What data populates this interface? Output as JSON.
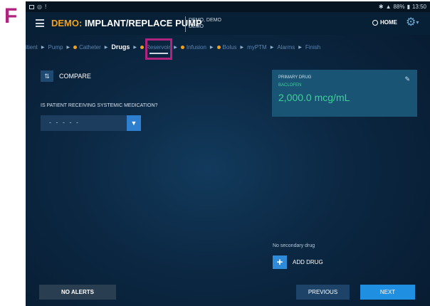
{
  "panel_label": "F",
  "status_bar": {
    "left_icons": [
      "image-icon",
      "target-icon",
      "alert-icon"
    ],
    "right_text": "88%",
    "time": "13:50"
  },
  "header": {
    "title_prefix": "DEMO:",
    "title_main": "IMPLANT/REPLACE PUMP",
    "patient_line1": "DEMO, DEMO",
    "patient_line2": "DEMO",
    "home_label": "HOME"
  },
  "steps": [
    {
      "label": "itient",
      "dot": false,
      "active": false
    },
    {
      "label": "Pump",
      "dot": false,
      "active": false
    },
    {
      "label": "Catheter",
      "dot": true,
      "active": false
    },
    {
      "label": "Drugs",
      "dot": false,
      "active": true
    },
    {
      "label": "Reservoir",
      "dot": true,
      "active": false
    },
    {
      "label": "Infusion",
      "dot": true,
      "active": false
    },
    {
      "label": "Bolus",
      "dot": true,
      "active": false
    },
    {
      "label": "myPTM",
      "dot": false,
      "active": false
    },
    {
      "label": "Alarms",
      "dot": false,
      "active": false
    },
    {
      "label": "Finish",
      "dot": false,
      "active": false
    }
  ],
  "compare": {
    "label": "COMPARE"
  },
  "systemic": {
    "question": "IS PATIENT RECEIVING SYSTEMIC MEDICATION?",
    "selected": "- - - - -"
  },
  "primary_drug": {
    "label": "PRIMARY DRUG",
    "name": "BACLOFEN",
    "concentration": "2,000.0 mcg/mL"
  },
  "secondary": {
    "none_text": "No secondary drug",
    "add_label": "ADD DRUG"
  },
  "footer": {
    "alerts_label": "NO ALERTS",
    "previous_label": "PREVIOUS",
    "next_label": "NEXT"
  },
  "colors": {
    "accent_orange": "#f0a21f",
    "highlight_magenta": "#b0237f",
    "drug_green": "#3fd09a",
    "primary_blue": "#1f8fe2"
  }
}
